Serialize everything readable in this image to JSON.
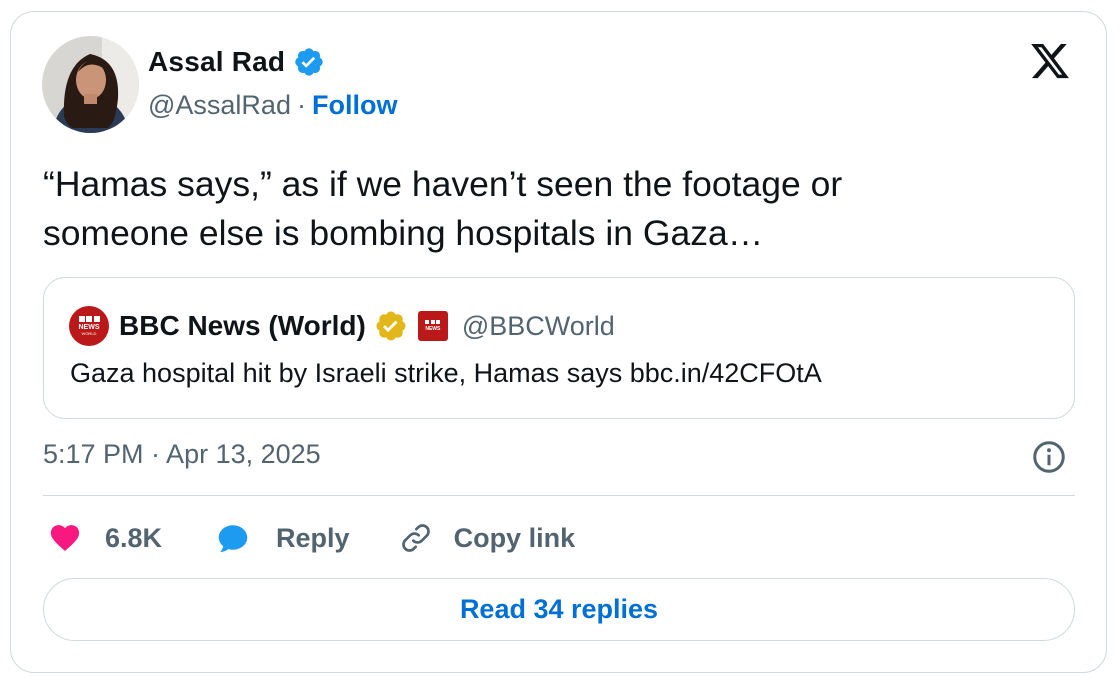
{
  "author": {
    "name": "Assal Rad",
    "handle": "@AssalRad",
    "separator": "·",
    "follow_label": "Follow"
  },
  "tweet": {
    "text_line1": "“Hamas says,” as if we haven’t seen the footage or",
    "text_line2": "someone else is bombing hospitals in Gaza…"
  },
  "quoted": {
    "name": "BBC News (World)",
    "handle": "@BBCWorld",
    "text": "Gaza hospital hit by Israeli strike, Hamas says bbc.in/42CFOtA",
    "logo_text": "NEWS",
    "logo_subtext": "WORLD"
  },
  "timestamp": "5:17 PM · Apr 13, 2025",
  "actions": {
    "likes": "6.8K",
    "reply_label": "Reply",
    "copy_label": "Copy link"
  },
  "read_replies_label": "Read 34 replies",
  "icons": {
    "verified": "verified-badge-icon",
    "gold": "gold-verified-badge-icon",
    "x_logo": "x-logo-icon",
    "info": "info-icon",
    "like": "heart-icon",
    "reply": "speech-bubble-icon",
    "copy": "link-icon"
  },
  "colors": {
    "text": "#0f1419",
    "muted": "#536471",
    "link": "#006fd6",
    "verified_blue": "#1d9bf0",
    "heart": "#f91880",
    "bbc_red": "#bb1919",
    "gold": "#e2b719",
    "border": "#cfd9de"
  }
}
